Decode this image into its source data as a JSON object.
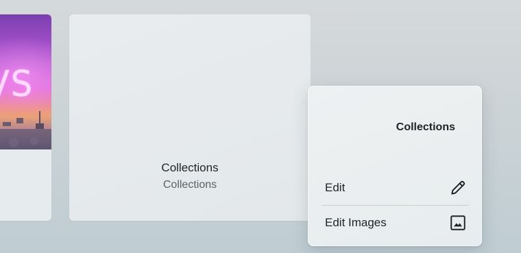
{
  "left_card": {
    "image_alt_text": "VS",
    "image_icon": "neon-city-thumbnail"
  },
  "main_card": {
    "title": "Collections",
    "subtitle": "Collections"
  },
  "context_menu": {
    "header": "Collections",
    "items": [
      {
        "label": "Edit",
        "icon": "pencil-icon"
      },
      {
        "label": "Edit Images",
        "icon": "image-icon"
      }
    ]
  },
  "colors": {
    "background": "#ccd3d6",
    "card": "#e6ebee",
    "menu": "#eef1f2",
    "text": "#1f2326",
    "muted_text": "#5b6166",
    "divider": "#c9d0d4"
  }
}
